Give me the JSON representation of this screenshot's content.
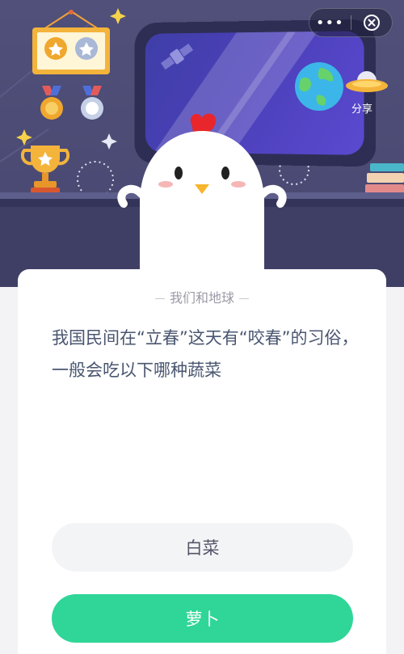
{
  "topbar": {
    "more_label": "•••",
    "close_icon": "close-circle-icon"
  },
  "scene": {
    "share_label": "分享",
    "icons": [
      "medal-frame-icon",
      "medal-icon",
      "trophy-icon",
      "satellite-icon",
      "earth-icon",
      "ufo-icon",
      "books-icon",
      "chick-mascot-icon"
    ]
  },
  "quiz": {
    "category": "我们和地球",
    "question": "我国民间在“立春”这天有“咬春”的习俗，一般会吃以下哪种蔬菜",
    "options": [
      {
        "label": "白菜"
      },
      {
        "label": "萝卜"
      }
    ]
  },
  "colors": {
    "scene_bg": "#4a4a73",
    "accent_green": "#2fd698",
    "option_gray": "#f3f4f6",
    "question_text": "#4a5670"
  }
}
